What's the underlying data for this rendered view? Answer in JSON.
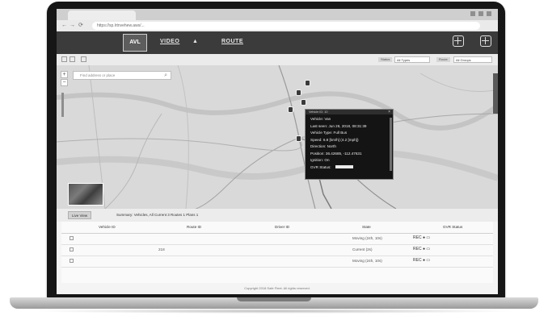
{
  "browser": {
    "tab_title": "",
    "url": "https://sp.lrtnvehew.aws/..."
  },
  "header": {
    "logo": "AVL",
    "nav": [
      "VIDEO",
      "ROUTE"
    ],
    "nav_extra": "",
    "icon_labels": [
      "",
      ""
    ]
  },
  "toolbar": {
    "filter1_label": "Status",
    "filter1_value": "All Types",
    "filter2_label": "Route",
    "filter2_value": "All Groups"
  },
  "map": {
    "search_placeholder": "Find address or place",
    "zoom_in": "+",
    "zoom_out": "−",
    "popup": {
      "title": "Vehicle ID: 10",
      "close": "×",
      "rows": [
        "Vehicle: Van",
        "Last seen: Jun 26, 2018, 08:31:39",
        "Vehicle Type: Full Bus",
        "Speed: 6.8 [km/h] (4.2 [mph])",
        "Direction: North",
        "Position: 36.42685, -112.47631",
        "Ignition: On",
        "GVR Status:"
      ]
    }
  },
  "bottom": {
    "tabs": [
      "Live View",
      "Summary: Vehicles, All Current 3 Routes 1 Plans 1"
    ]
  },
  "table": {
    "columns": [
      "Vehicle ID",
      "Route ID",
      "Driver ID",
      "State",
      "GVR Status"
    ],
    "rows": [
      {
        "vehicle": "",
        "route": "",
        "driver": "",
        "state": "Moving (24h, 10s)",
        "status": "REC"
      },
      {
        "vehicle": "",
        "route": "218",
        "driver": "",
        "state": "Current (2s)",
        "status": "REC"
      },
      {
        "vehicle": "",
        "route": "",
        "driver": "",
        "state": "Moving (24h, 10s)",
        "status": "REC"
      }
    ]
  },
  "footer": "Copyright 2018 Safe Fleet. All rights reserved."
}
